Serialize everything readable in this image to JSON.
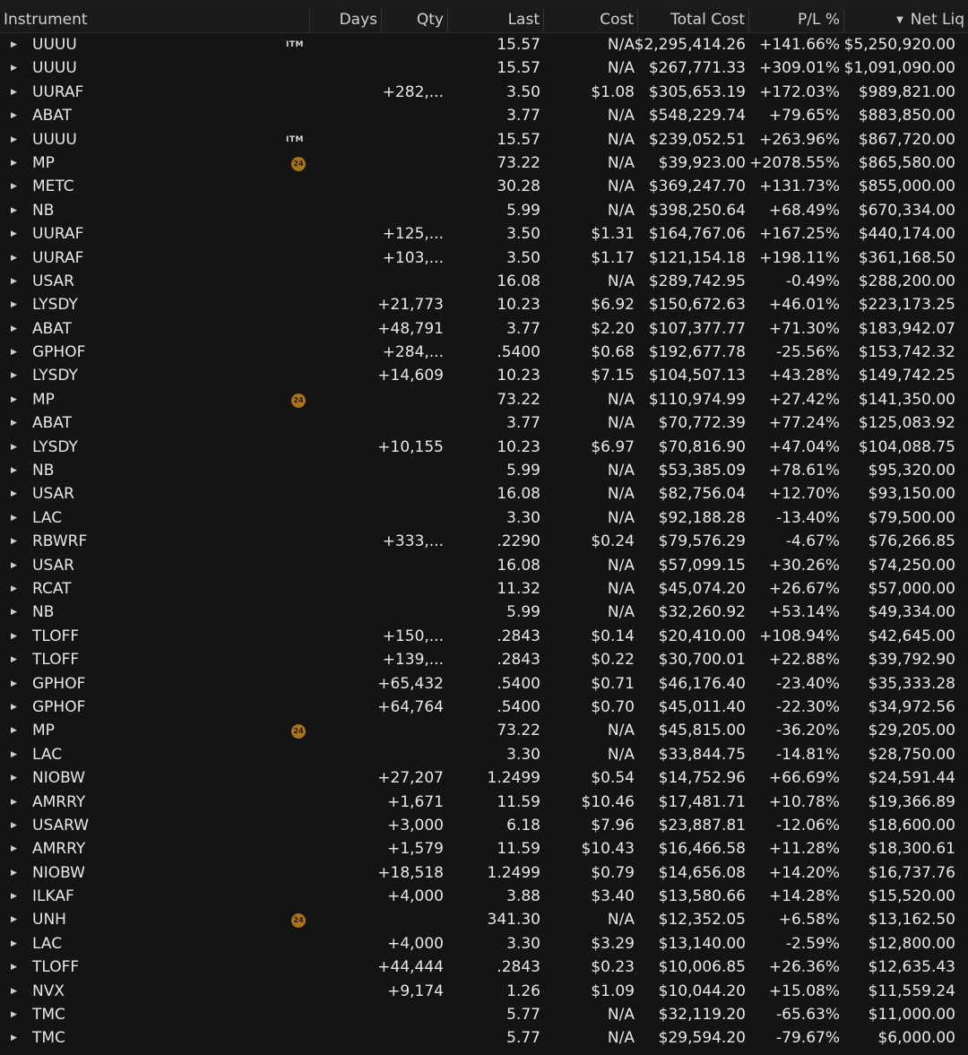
{
  "columns": {
    "instrument": "Instrument",
    "days": "Days",
    "qty": "Qty",
    "last": "Last",
    "cost": "Cost",
    "total_cost": "Total Cost",
    "pl_pct": "P/L %",
    "net_liq": "Net Liq"
  },
  "icons": {
    "expand": "triangle-right-icon",
    "sort": "sort-descending-icon",
    "itm_badge": "ITM",
    "earnings_badge": "24"
  },
  "colors": {
    "background": "#141414",
    "text": "#e8e8e8",
    "badge": "#a8731a"
  },
  "rows": [
    {
      "sym": "UUUU",
      "tag": "ITM",
      "qty": "",
      "last": "15.57",
      "cost": "N/A",
      "total_cost": "$2,295,414.26",
      "pl": "+141.66%",
      "netliq": "$5,250,920.00"
    },
    {
      "sym": "UUUU",
      "tag": "",
      "qty": "",
      "last": "15.57",
      "cost": "N/A",
      "total_cost": "$267,771.33",
      "pl": "+309.01%",
      "netliq": "$1,091,090.00"
    },
    {
      "sym": "UURAF",
      "tag": "",
      "qty": "+282,...",
      "last": "3.50",
      "cost": "$1.08",
      "total_cost": "$305,653.19",
      "pl": "+172.03%",
      "netliq": "$989,821.00"
    },
    {
      "sym": "ABAT",
      "tag": "",
      "qty": "",
      "last": "3.77",
      "cost": "N/A",
      "total_cost": "$548,229.74",
      "pl": "+79.65%",
      "netliq": "$883,850.00"
    },
    {
      "sym": "UUUU",
      "tag": "ITM",
      "qty": "",
      "last": "15.57",
      "cost": "N/A",
      "total_cost": "$239,052.51",
      "pl": "+263.96%",
      "netliq": "$867,720.00"
    },
    {
      "sym": "MP",
      "tag": "24",
      "qty": "",
      "last": "73.22",
      "cost": "N/A",
      "total_cost": "$39,923.00",
      "pl": "+2078.55%",
      "netliq": "$865,580.00"
    },
    {
      "sym": "METC",
      "tag": "",
      "qty": "",
      "last": "30.28",
      "cost": "N/A",
      "total_cost": "$369,247.70",
      "pl": "+131.73%",
      "netliq": "$855,000.00"
    },
    {
      "sym": "NB",
      "tag": "",
      "qty": "",
      "last": "5.99",
      "cost": "N/A",
      "total_cost": "$398,250.64",
      "pl": "+68.49%",
      "netliq": "$670,334.00"
    },
    {
      "sym": "UURAF",
      "tag": "",
      "qty": "+125,...",
      "last": "3.50",
      "cost": "$1.31",
      "total_cost": "$164,767.06",
      "pl": "+167.25%",
      "netliq": "$440,174.00"
    },
    {
      "sym": "UURAF",
      "tag": "",
      "qty": "+103,...",
      "last": "3.50",
      "cost": "$1.17",
      "total_cost": "$121,154.18",
      "pl": "+198.11%",
      "netliq": "$361,168.50"
    },
    {
      "sym": "USAR",
      "tag": "",
      "qty": "",
      "last": "16.08",
      "cost": "N/A",
      "total_cost": "$289,742.95",
      "pl": "-0.49%",
      "netliq": "$288,200.00"
    },
    {
      "sym": "LYSDY",
      "tag": "",
      "qty": "+21,773",
      "last": "10.23",
      "cost": "$6.92",
      "total_cost": "$150,672.63",
      "pl": "+46.01%",
      "netliq": "$223,173.25"
    },
    {
      "sym": "ABAT",
      "tag": "",
      "qty": "+48,791",
      "last": "3.77",
      "cost": "$2.20",
      "total_cost": "$107,377.77",
      "pl": "+71.30%",
      "netliq": "$183,942.07"
    },
    {
      "sym": "GPHOF",
      "tag": "",
      "qty": "+284,...",
      "last": ".5400",
      "cost": "$0.68",
      "total_cost": "$192,677.78",
      "pl": "-25.56%",
      "netliq": "$153,742.32"
    },
    {
      "sym": "LYSDY",
      "tag": "",
      "qty": "+14,609",
      "last": "10.23",
      "cost": "$7.15",
      "total_cost": "$104,507.13",
      "pl": "+43.28%",
      "netliq": "$149,742.25"
    },
    {
      "sym": "MP",
      "tag": "24",
      "qty": "",
      "last": "73.22",
      "cost": "N/A",
      "total_cost": "$110,974.99",
      "pl": "+27.42%",
      "netliq": "$141,350.00"
    },
    {
      "sym": "ABAT",
      "tag": "",
      "qty": "",
      "last": "3.77",
      "cost": "N/A",
      "total_cost": "$70,772.39",
      "pl": "+77.24%",
      "netliq": "$125,083.92"
    },
    {
      "sym": "LYSDY",
      "tag": "",
      "qty": "+10,155",
      "last": "10.23",
      "cost": "$6.97",
      "total_cost": "$70,816.90",
      "pl": "+47.04%",
      "netliq": "$104,088.75"
    },
    {
      "sym": "NB",
      "tag": "",
      "qty": "",
      "last": "5.99",
      "cost": "N/A",
      "total_cost": "$53,385.09",
      "pl": "+78.61%",
      "netliq": "$95,320.00"
    },
    {
      "sym": "USAR",
      "tag": "",
      "qty": "",
      "last": "16.08",
      "cost": "N/A",
      "total_cost": "$82,756.04",
      "pl": "+12.70%",
      "netliq": "$93,150.00"
    },
    {
      "sym": "LAC",
      "tag": "",
      "qty": "",
      "last": "3.30",
      "cost": "N/A",
      "total_cost": "$92,188.28",
      "pl": "-13.40%",
      "netliq": "$79,500.00"
    },
    {
      "sym": "RBWRF",
      "tag": "",
      "qty": "+333,...",
      "last": ".2290",
      "cost": "$0.24",
      "total_cost": "$79,576.29",
      "pl": "-4.67%",
      "netliq": "$76,266.85"
    },
    {
      "sym": "USAR",
      "tag": "",
      "qty": "",
      "last": "16.08",
      "cost": "N/A",
      "total_cost": "$57,099.15",
      "pl": "+30.26%",
      "netliq": "$74,250.00"
    },
    {
      "sym": "RCAT",
      "tag": "",
      "qty": "",
      "last": "11.32",
      "cost": "N/A",
      "total_cost": "$45,074.20",
      "pl": "+26.67%",
      "netliq": "$57,000.00"
    },
    {
      "sym": "NB",
      "tag": "",
      "qty": "",
      "last": "5.99",
      "cost": "N/A",
      "total_cost": "$32,260.92",
      "pl": "+53.14%",
      "netliq": "$49,334.00"
    },
    {
      "sym": "TLOFF",
      "tag": "",
      "qty": "+150,...",
      "last": ".2843",
      "cost": "$0.14",
      "total_cost": "$20,410.00",
      "pl": "+108.94%",
      "netliq": "$42,645.00"
    },
    {
      "sym": "TLOFF",
      "tag": "",
      "qty": "+139,...",
      "last": ".2843",
      "cost": "$0.22",
      "total_cost": "$30,700.01",
      "pl": "+22.88%",
      "netliq": "$39,792.90"
    },
    {
      "sym": "GPHOF",
      "tag": "",
      "qty": "+65,432",
      "last": ".5400",
      "cost": "$0.71",
      "total_cost": "$46,176.40",
      "pl": "-23.40%",
      "netliq": "$35,333.28"
    },
    {
      "sym": "GPHOF",
      "tag": "",
      "qty": "+64,764",
      "last": ".5400",
      "cost": "$0.70",
      "total_cost": "$45,011.40",
      "pl": "-22.30%",
      "netliq": "$34,972.56"
    },
    {
      "sym": "MP",
      "tag": "24",
      "qty": "",
      "last": "73.22",
      "cost": "N/A",
      "total_cost": "$45,815.00",
      "pl": "-36.20%",
      "netliq": "$29,205.00"
    },
    {
      "sym": "LAC",
      "tag": "",
      "qty": "",
      "last": "3.30",
      "cost": "N/A",
      "total_cost": "$33,844.75",
      "pl": "-14.81%",
      "netliq": "$28,750.00"
    },
    {
      "sym": "NIOBW",
      "tag": "",
      "qty": "+27,207",
      "last": "1.2499",
      "cost": "$0.54",
      "total_cost": "$14,752.96",
      "pl": "+66.69%",
      "netliq": "$24,591.44"
    },
    {
      "sym": "AMRRY",
      "tag": "",
      "qty": "+1,671",
      "last": "11.59",
      "cost": "$10.46",
      "total_cost": "$17,481.71",
      "pl": "+10.78%",
      "netliq": "$19,366.89"
    },
    {
      "sym": "USARW",
      "tag": "",
      "qty": "+3,000",
      "last": "6.18",
      "cost": "$7.96",
      "total_cost": "$23,887.81",
      "pl": "-12.06%",
      "netliq": "$18,600.00"
    },
    {
      "sym": "AMRRY",
      "tag": "",
      "qty": "+1,579",
      "last": "11.59",
      "cost": "$10.43",
      "total_cost": "$16,466.58",
      "pl": "+11.28%",
      "netliq": "$18,300.61"
    },
    {
      "sym": "NIOBW",
      "tag": "",
      "qty": "+18,518",
      "last": "1.2499",
      "cost": "$0.79",
      "total_cost": "$14,656.08",
      "pl": "+14.20%",
      "netliq": "$16,737.76"
    },
    {
      "sym": "ILKAF",
      "tag": "",
      "qty": "+4,000",
      "last": "3.88",
      "cost": "$3.40",
      "total_cost": "$13,580.66",
      "pl": "+14.28%",
      "netliq": "$15,520.00"
    },
    {
      "sym": "UNH",
      "tag": "24",
      "qty": "",
      "last": "341.30",
      "cost": "N/A",
      "total_cost": "$12,352.05",
      "pl": "+6.58%",
      "netliq": "$13,162.50"
    },
    {
      "sym": "LAC",
      "tag": "",
      "qty": "+4,000",
      "last": "3.30",
      "cost": "$3.29",
      "total_cost": "$13,140.00",
      "pl": "-2.59%",
      "netliq": "$12,800.00"
    },
    {
      "sym": "TLOFF",
      "tag": "",
      "qty": "+44,444",
      "last": ".2843",
      "cost": "$0.23",
      "total_cost": "$10,006.85",
      "pl": "+26.36%",
      "netliq": "$12,635.43"
    },
    {
      "sym": "NVX",
      "tag": "",
      "qty": "+9,174",
      "last": "1.26",
      "cost": "$1.09",
      "total_cost": "$10,044.20",
      "pl": "+15.08%",
      "netliq": "$11,559.24"
    },
    {
      "sym": "TMC",
      "tag": "",
      "qty": "",
      "last": "5.77",
      "cost": "N/A",
      "total_cost": "$32,119.20",
      "pl": "-65.63%",
      "netliq": "$11,000.00"
    },
    {
      "sym": "TMC",
      "tag": "",
      "qty": "",
      "last": "5.77",
      "cost": "N/A",
      "total_cost": "$29,594.20",
      "pl": "-79.67%",
      "netliq": "$6,000.00"
    }
  ]
}
